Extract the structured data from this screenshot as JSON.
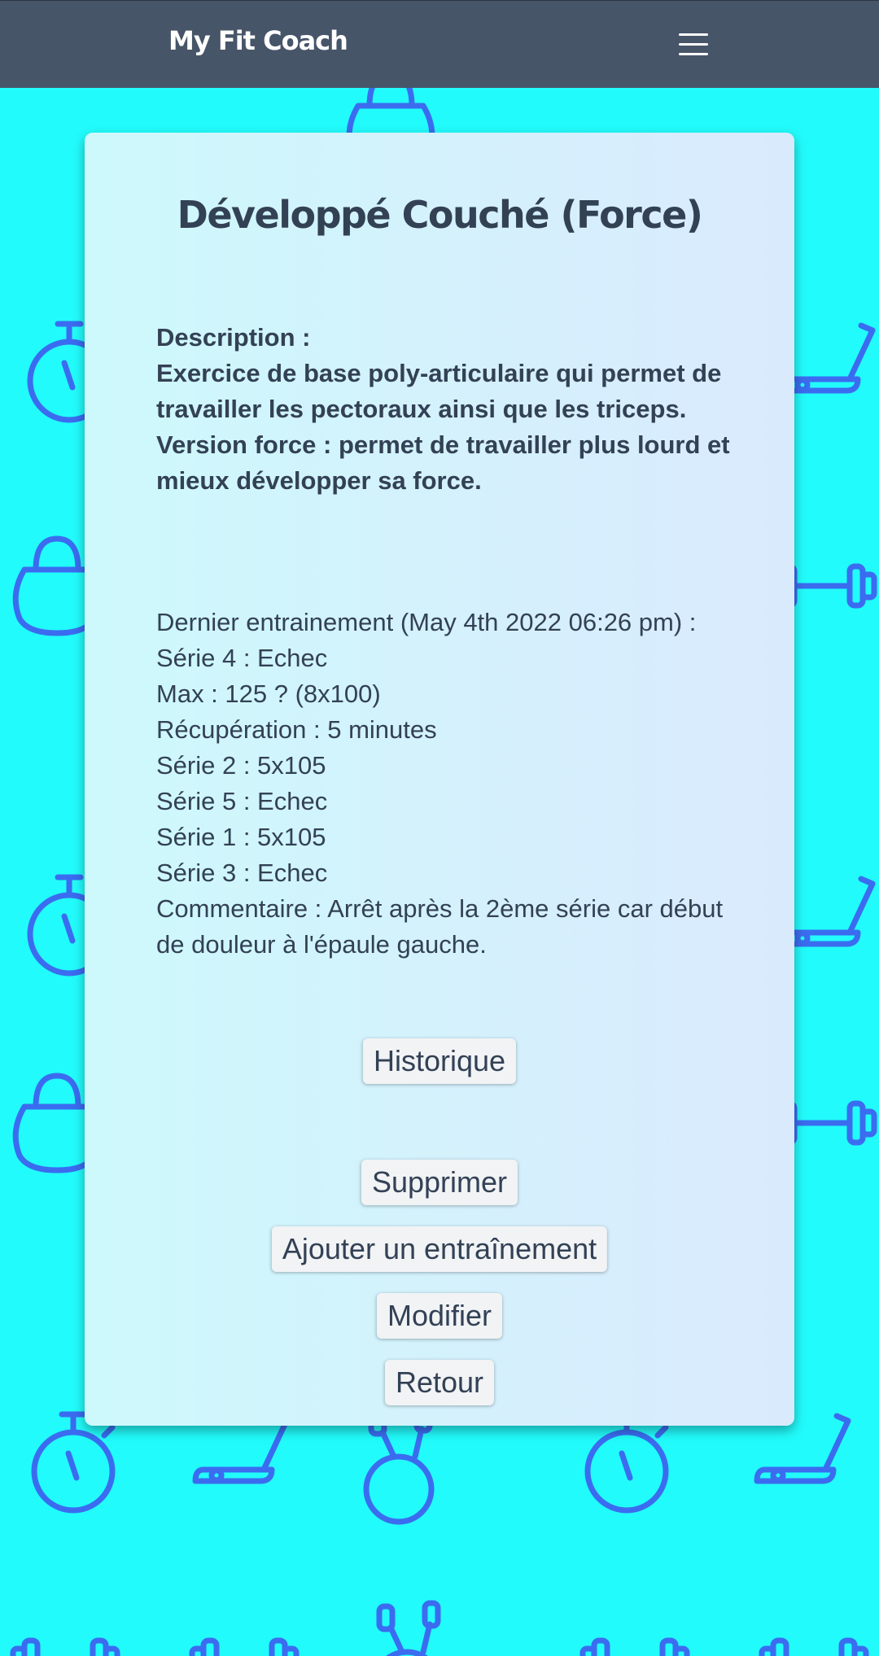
{
  "navbar": {
    "brand": "My Fit Coach",
    "menu_icon": "hamburger-menu-icon"
  },
  "exercise": {
    "title": "Développé Couché (Force)",
    "description_label": "Description :",
    "description_lines": [
      "Exercice de base poly-articulaire qui permet de travailler les pectoraux ainsi que les triceps.",
      "Version force : permet de travailler plus lourd et mieux développer sa force."
    ]
  },
  "last_training": {
    "heading": "Dernier entrainement (May 4th 2022 06:26 pm) :",
    "lines": [
      "Série 4 : Echec",
      "Max : 125 ? (8x100)",
      "Récupération : 5 minutes",
      "Série 2 : 5x105",
      "Série 5 : Echec",
      "Série 1 : 5x105",
      "Série 3 : Echec",
      "Commentaire : Arrêt après la 2ème série car début de douleur à l'épaule gauche."
    ]
  },
  "buttons": {
    "history": "Historique",
    "delete": "Supprimer",
    "add_training": "Ajouter un entraînement",
    "edit": "Modifier",
    "back": "Retour"
  },
  "colors": {
    "background": "#22fbfb",
    "navbar": "#475569",
    "pattern_icons": "#3b6cf0",
    "text": "#334155"
  }
}
